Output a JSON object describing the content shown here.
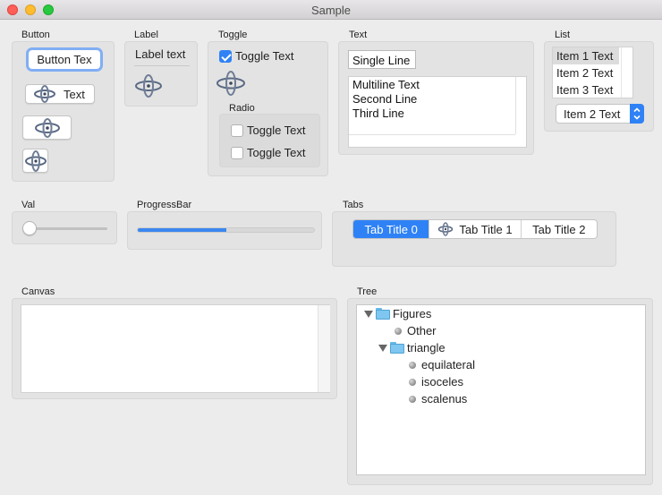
{
  "window": {
    "title": "Sample"
  },
  "button": {
    "label": "Button",
    "focused_button": "Button Tex",
    "icon_text_button": "Text"
  },
  "label": {
    "label": "Label",
    "text": "Label text"
  },
  "toggle": {
    "label": "Toggle",
    "toggle_text": "Toggle Text",
    "checked": true,
    "radio": {
      "label": "Radio",
      "options": [
        "Toggle Text",
        "Toggle Text"
      ]
    }
  },
  "text": {
    "label": "Text",
    "single_line": "Single Line",
    "multiline": [
      "Multiline Text",
      "Second Line",
      "Third Line"
    ]
  },
  "list": {
    "label": "List",
    "items": [
      "Item 1 Text",
      "Item 2 Text",
      "Item 3 Text"
    ],
    "selected_index": 0,
    "popup_value": "Item 2 Text"
  },
  "val": {
    "label": "Val",
    "value_fraction": 0.0
  },
  "progress": {
    "label": "ProgressBar",
    "fraction": 0.5
  },
  "tabs": {
    "label": "Tabs",
    "items": [
      "Tab Title 0",
      "Tab Title 1",
      "Tab Title 2"
    ],
    "active_index": 0
  },
  "canvas": {
    "label": "Canvas"
  },
  "tree": {
    "label": "Tree",
    "root": "Figures",
    "other": "Other",
    "triangle": "triangle",
    "leaves": [
      "equilateral",
      "isoceles",
      "scalenus"
    ]
  },
  "colors": {
    "accent": "#2f82f5",
    "folder": "#7fc7f0"
  }
}
